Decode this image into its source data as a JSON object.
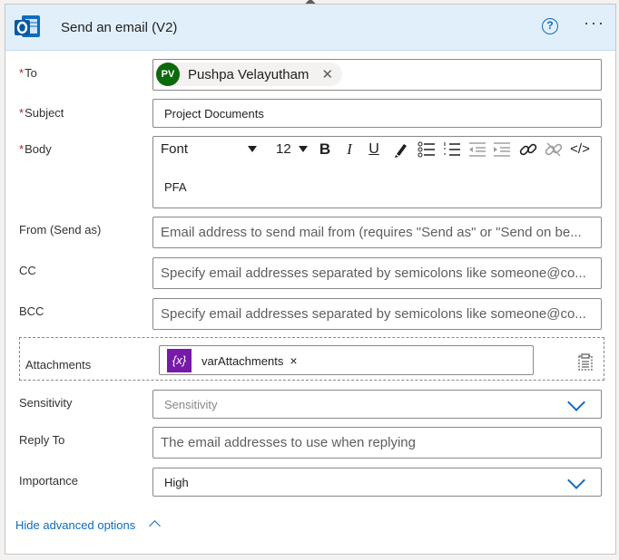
{
  "header": {
    "title": "Send an email (V2)",
    "app_icon": "outlook-icon",
    "help_icon_glyph": "?",
    "more_icon_glyph": "···"
  },
  "to": {
    "label": "To",
    "required_mark": "*",
    "recipient": {
      "initials": "PV",
      "name": "Pushpa Velayutham",
      "avatar_color": "#0b6a0b",
      "remove_glyph": "✕"
    }
  },
  "subject": {
    "label": "Subject",
    "required_mark": "*",
    "value": "Project Documents"
  },
  "body": {
    "label": "Body",
    "required_mark": "*",
    "font": "Font",
    "font_size": "12",
    "toolbar": {
      "bold": "B",
      "italic": "I",
      "underline": "U",
      "code": "</>"
    },
    "value": "PFA"
  },
  "from": {
    "label": "From (Send as)",
    "placeholder": "Email address to send mail from (requires \"Send as\" or \"Send on be..."
  },
  "cc": {
    "label": "CC",
    "placeholder": "Specify email addresses separated by semicolons like someone@co..."
  },
  "bcc": {
    "label": "BCC",
    "placeholder": "Specify email addresses separated by semicolons like someone@co..."
  },
  "attachments": {
    "label": "Attachments",
    "variable_glyph": "{x}",
    "variable_color": "#7719aa",
    "variable_name": "varAttachments",
    "remove_glyph": "×"
  },
  "sensitivity": {
    "label": "Sensitivity",
    "placeholder": "Sensitivity"
  },
  "reply_to": {
    "label": "Reply To",
    "placeholder": "The email addresses to use when replying"
  },
  "importance": {
    "label": "Importance",
    "value": "High"
  },
  "footer": {
    "hide_advanced_label": "Hide advanced options"
  },
  "colors": {
    "header_bg": "#e1effa",
    "accent": "#0f6cbd",
    "required": "#a4262c"
  }
}
